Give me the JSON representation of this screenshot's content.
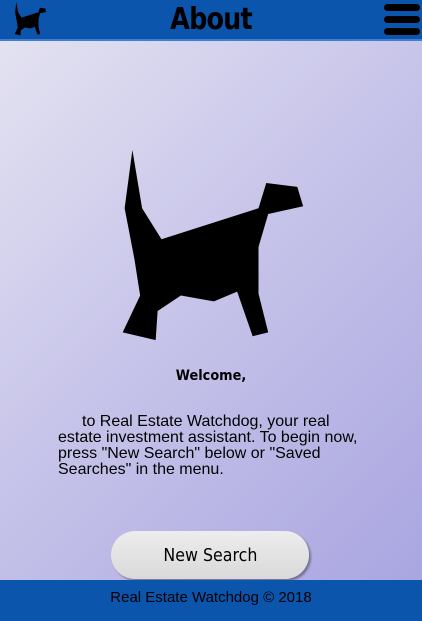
{
  "header": {
    "title": "About",
    "logo_icon": "dog-icon",
    "menu_icon": "hamburger-menu-icon"
  },
  "main": {
    "hero_icon": "dog-silhouette-icon",
    "welcome_heading": "Welcome,",
    "intro_text": "to Real Estate Watchdog, your real estate investment assistant. To begin now, press \"New Search\" below or \"Saved Searches\" in the menu.",
    "new_search_label": "New Search"
  },
  "footer": {
    "copyright": "Real Estate Watchdog © 2018"
  },
  "colors": {
    "bar_blue": "#0b55ac",
    "background_light": "#e6e5f1",
    "background_dark": "#a7a3e0",
    "button_grey": "#e0e0e0"
  }
}
